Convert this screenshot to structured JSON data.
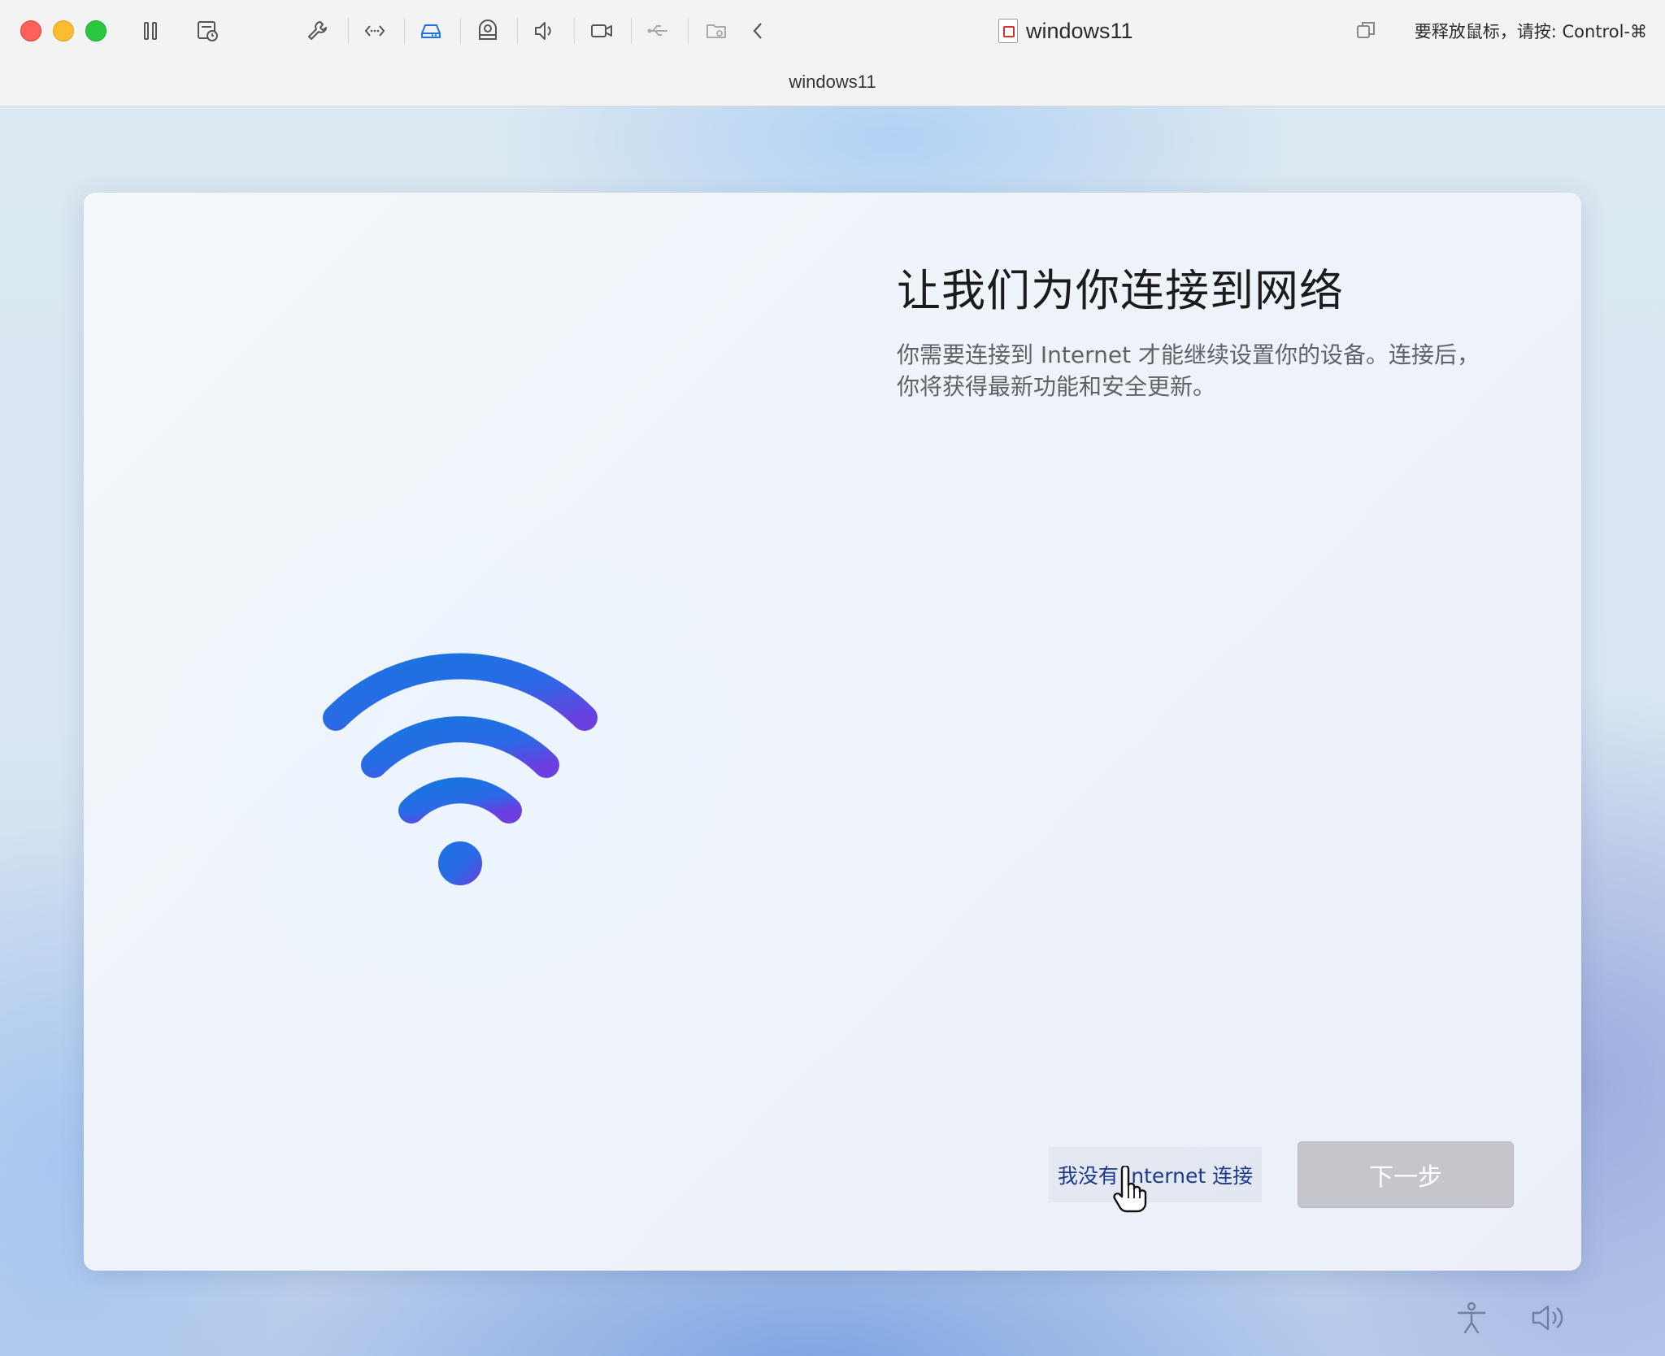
{
  "titlebar": {
    "window_title": "windows11",
    "tab_title": "windows11",
    "release_hint": "要释放鼠标，请按: Control-⌘",
    "toolbar_icons": [
      "pause-icon",
      "snapshot-icon",
      "settings-wrench-icon",
      "network-icon",
      "hard-disk-icon",
      "camera-device-icon",
      "sound-icon",
      "video-camera-icon",
      "usb-icon",
      "shared-folder-icon",
      "chevron-left-icon"
    ]
  },
  "oobe": {
    "heading": "让我们为你连接到网络",
    "description": "你需要连接到 Internet 才能继续设置你的设备。连接后，你将获得最新功能和安全更新。",
    "no_internet_label": "我没有 Internet 连接",
    "next_label": "下一步"
  },
  "taskbar": {
    "icons": [
      "accessibility-icon",
      "volume-icon"
    ]
  },
  "colors": {
    "wifi_gradient_start": "#1a74e0",
    "wifi_gradient_end": "#6b3fe0",
    "next_button_disabled": "#c4c6cb",
    "link_text": "#1f3a8a"
  }
}
